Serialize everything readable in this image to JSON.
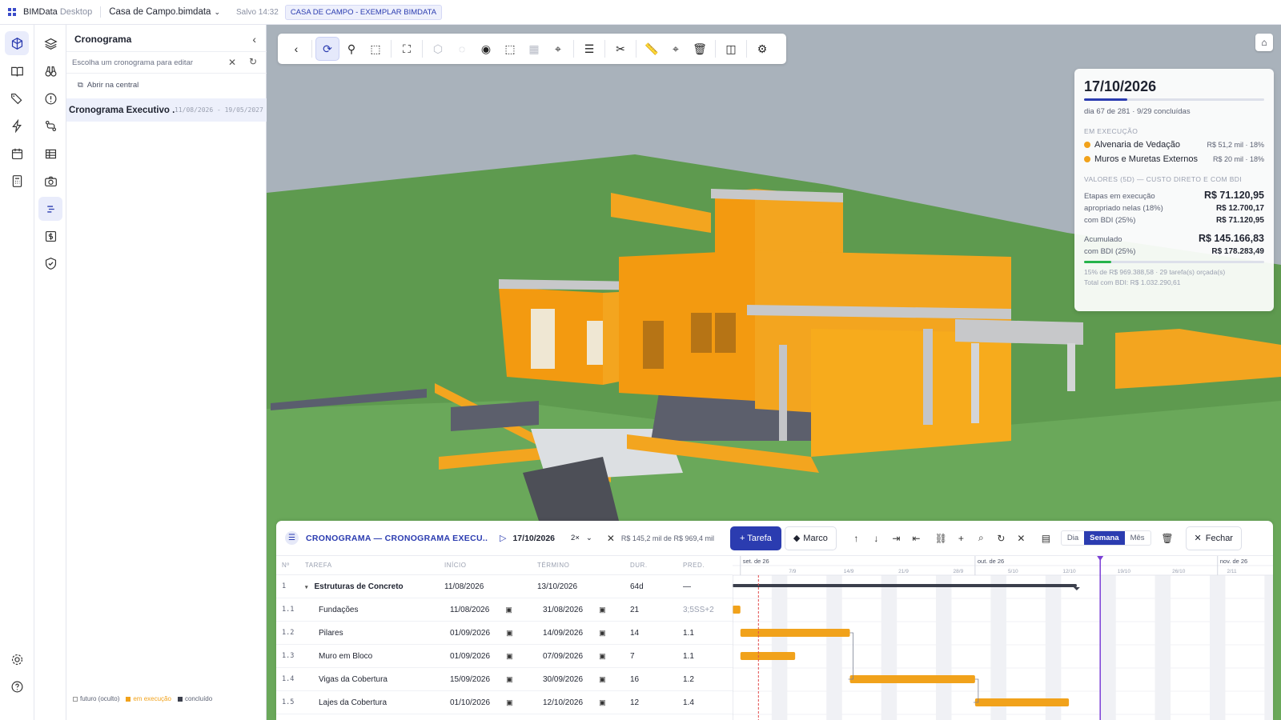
{
  "topbar": {
    "app": "BIMData",
    "app_suffix": "Desktop",
    "file": "Casa de Campo.bimdata",
    "saved": "Salvo 14:32",
    "project": "CASA DE CAMPO - EXEMPLAR BIMDATA"
  },
  "panel": {
    "title": "Cronograma",
    "search_placeholder": "Escolha um cronograma para editar",
    "open_link": "Abrir na central",
    "item_name": "Cronograma Executivo ...",
    "item_dates": "11/08/2026 - 19/05/2027",
    "legend": [
      "futuro (oculto)",
      "em execução",
      "concluído"
    ]
  },
  "card": {
    "date": "17/10/2026",
    "progress": 0.24,
    "subtitle": "dia 67 de 281 · 9/29 concluídas",
    "running_label": "EM EXECUÇÃO",
    "running": [
      {
        "name": "Alvenaria de Vedação",
        "value": "R$ 51,2 mil · 18%"
      },
      {
        "name": "Muros e Muretas Externos",
        "value": "R$ 20 mil · 18%"
      }
    ],
    "values_label": "VALORES (5D) — CUSTO DIRETO E COM BDI",
    "stage_label": "Etapas em execução",
    "stage_value": "R$ 71.120,95",
    "appropriated_label": "apropriado nelas (18%)",
    "appropriated_value": "R$ 12.700,17",
    "bdi_label": "com BDI (25%)",
    "bdi_value": "R$ 71.120,95",
    "acc_label": "Acumulado",
    "acc_value": "R$ 145.166,83",
    "acc_bdi_label": "com BDI (25%)",
    "acc_bdi_value": "R$ 178.283,49",
    "acc_progress": 0.15,
    "foot1": "15% de R$ 969.388,58 · 29 tarefa(s) orçada(s)",
    "foot2": "Total com BDI: R$ 1.032.290,61"
  },
  "gantt": {
    "title": "CRONOGRAMA — CRONOGRAMA EXECU...",
    "date": "17/10/2026",
    "speed": "2×",
    "values": "R$ 145,2 mil de R$ 969,4 mil",
    "task_btn": "+ Tarefa",
    "milestone_btn": "Marco",
    "views": [
      "Dia",
      "Semana",
      "Mês"
    ],
    "active_view": "Semana",
    "close": "Fechar",
    "headers": [
      "Nº",
      "TAREFA",
      "INÍCIO",
      "TÉRMINO",
      "DUR.",
      "PRED."
    ],
    "rows": [
      {
        "n": "1",
        "task": "Estruturas de Concreto",
        "start": "11/08/2026",
        "end": "13/10/2026",
        "dur": "64d",
        "pred": "—",
        "group": true
      },
      {
        "n": "1.1",
        "task": "Fundações",
        "start": "11/08/2026",
        "end": "31/08/2026",
        "dur": "21",
        "pred": "3;5SS+2"
      },
      {
        "n": "1.2",
        "task": "Pilares",
        "start": "01/09/2026",
        "end": "14/09/2026",
        "dur": "14",
        "pred": "1.1"
      },
      {
        "n": "1.3",
        "task": "Muro em Bloco",
        "start": "01/09/2026",
        "end": "07/09/2026",
        "dur": "7",
        "pred": "1.1"
      },
      {
        "n": "1.4",
        "task": "Vigas da Cobertura",
        "start": "15/09/2026",
        "end": "30/09/2026",
        "dur": "16",
        "pred": "1.2"
      },
      {
        "n": "1.5",
        "task": "Lajes da Cobertura",
        "start": "01/10/2026",
        "end": "12/10/2026",
        "dur": "12",
        "pred": "1.4"
      }
    ],
    "months": [
      "set. de 26",
      "out. de 26",
      "nov. de 26"
    ],
    "weeks": [
      "7/9",
      "14/9",
      "21/9",
      "28/9",
      "5/10",
      "12/10",
      "19/10",
      "26/10",
      "2/11"
    ]
  },
  "colors": {
    "accent": "#2b3cb0",
    "running": "#f1a21b",
    "done": "#3b3f4c",
    "today": "#7b3fd6"
  }
}
